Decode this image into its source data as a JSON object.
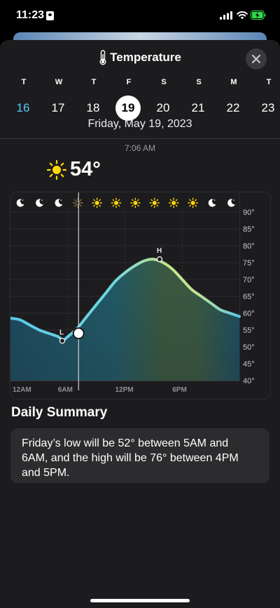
{
  "status_bar": {
    "time": "11:23"
  },
  "sheet": {
    "title": "Temperature",
    "week_days": [
      {
        "letter": "T",
        "num": "16",
        "state": "today"
      },
      {
        "letter": "W",
        "num": "17",
        "state": ""
      },
      {
        "letter": "T",
        "num": "18",
        "state": ""
      },
      {
        "letter": "F",
        "num": "19",
        "state": "selected"
      },
      {
        "letter": "S",
        "num": "20",
        "state": ""
      },
      {
        "letter": "S",
        "num": "21",
        "state": ""
      },
      {
        "letter": "M",
        "num": "22",
        "state": ""
      },
      {
        "letter": "T",
        "num": "23",
        "state": ""
      }
    ],
    "selected_date": "Friday, May 19, 2023",
    "current_time": "7:06 AM",
    "current_temp": "54°"
  },
  "colors": {
    "accent_blue": "#5ac8fa",
    "sun": "#ffd60a",
    "line_cool": "#5ac8e6",
    "line_warm": "#c3e48c"
  },
  "chart_data": {
    "type": "area",
    "x_unit": "hour",
    "x": [
      0,
      1,
      2,
      3,
      4,
      5,
      5.5,
      6,
      7,
      8,
      9,
      10,
      11,
      12,
      13,
      14,
      15,
      16,
      17,
      18,
      19,
      20,
      21,
      22,
      23,
      24
    ],
    "values": [
      58.5,
      58,
      56.5,
      55,
      54,
      53,
      52,
      53,
      55.5,
      59,
      62.5,
      66,
      69.5,
      72,
      74,
      75.5,
      76,
      75,
      73,
      70,
      67,
      65,
      63,
      61,
      60,
      59
    ],
    "ylim": [
      40,
      90
    ],
    "y_ticks": [
      "40°",
      "45°",
      "50°",
      "55°",
      "60°",
      "65°",
      "70°",
      "75°",
      "80°",
      "85°",
      "90°"
    ],
    "x_ticks": [
      {
        "hour": 0,
        "label": "12AM"
      },
      {
        "hour": 6,
        "label": "6AM"
      },
      {
        "hour": 12,
        "label": "12PM"
      },
      {
        "hour": 18,
        "label": "6PM"
      }
    ],
    "low": {
      "hour": 5.5,
      "value": 52,
      "label": "L"
    },
    "high": {
      "hour": 16,
      "value": 76,
      "label": "H"
    },
    "selected": {
      "hour": 7.1,
      "value": 54
    },
    "condition_icons": [
      "moon-icon",
      "moon-icon",
      "moon-icon",
      "sun-icon",
      "sun-icon",
      "sun-icon",
      "sun-icon",
      "sun-icon",
      "sun-icon",
      "sun-icon",
      "moon-icon",
      "moon-icon"
    ]
  },
  "summary": {
    "title": "Daily Summary",
    "lines": [
      "Friday’s low will be 52° between 5AM and",
      "6AM, and the high will be 76° between 4PM",
      "and 5PM."
    ]
  }
}
